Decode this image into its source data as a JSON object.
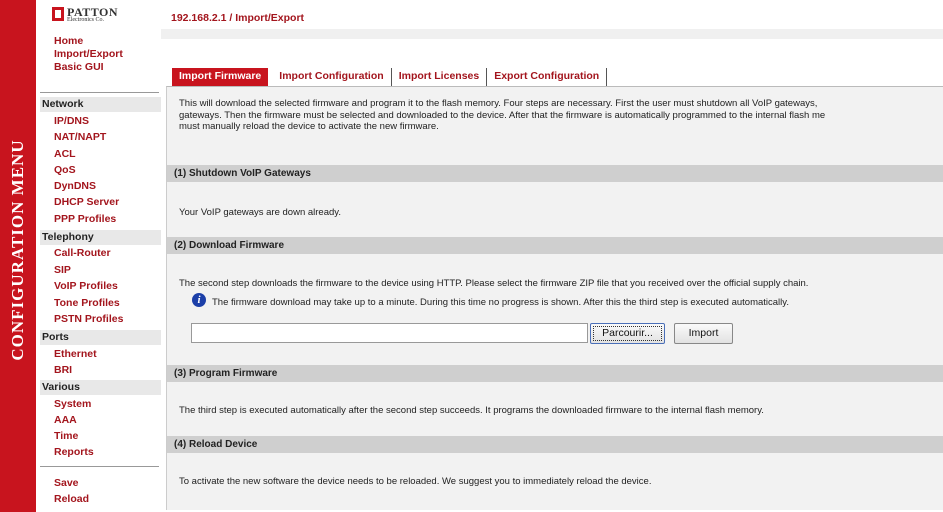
{
  "sidebar": {
    "vertical_title": "CONFIGURATION MENU",
    "logo_name": "PATTON",
    "logo_sub": "Electronics Co.",
    "top_links": [
      "Home",
      "Import/Export",
      "Basic GUI"
    ],
    "groups": [
      {
        "title": "Network",
        "items": [
          "IP/DNS",
          "NAT/NAPT",
          "ACL",
          "QoS",
          "DynDNS",
          "DHCP Server",
          "PPP Profiles"
        ]
      },
      {
        "title": "Telephony",
        "items": [
          "Call-Router",
          "SIP",
          "VoIP Profiles",
          "Tone Profiles",
          "PSTN Profiles"
        ]
      },
      {
        "title": "Ports",
        "items": [
          "Ethernet",
          "BRI"
        ]
      },
      {
        "title": "Various",
        "items": [
          "System",
          "AAA",
          "Time",
          "Reports"
        ]
      }
    ],
    "bottom_links": [
      "Save",
      "Reload"
    ]
  },
  "breadcrumb": "192.168.2.1 / Import/Export",
  "tabs": [
    "Import Firmware",
    "Import Configuration",
    "Import Licenses",
    "Export Configuration"
  ],
  "intro_lines": [
    "This will download the selected firmware and program it to the flash memory. Four steps are necessary. First the user must shutdown all VoIP gateways,",
    "gateways. Then the firmware must be selected and downloaded to the device. After that the firmware is automatically programmed to the internal flash me",
    "must manually reload the device to activate the new firmware."
  ],
  "sections": [
    {
      "title": "(1) Shutdown VoIP Gateways",
      "text": "Your VoIP gateways are down already."
    },
    {
      "title": "(2) Download Firmware",
      "text": "The second step downloads the firmware to the device using HTTP. Please select the firmware ZIP file that you received over the official supply chain.",
      "info": "The firmware download may take up to a minute. During this time no progress is shown. After this the third step is executed automatically."
    },
    {
      "title": "(3) Program Firmware",
      "text": "The third step is executed automatically after the second step succeeds. It programs the downloaded firmware to the internal flash memory."
    },
    {
      "title": "(4) Reload Device",
      "text": "To activate the new software the device needs to be reloaded. We suggest you to immediately reload the device."
    }
  ],
  "file_input_value": "",
  "browse_label": "Parcourir...",
  "import_label": "Import",
  "colors": {
    "accent_red": "#c8141e",
    "link_red": "#a3151d",
    "section_gray": "#cfcfcf",
    "info_blue": "#1c3fa8"
  },
  "icons": [
    "info-icon"
  ]
}
